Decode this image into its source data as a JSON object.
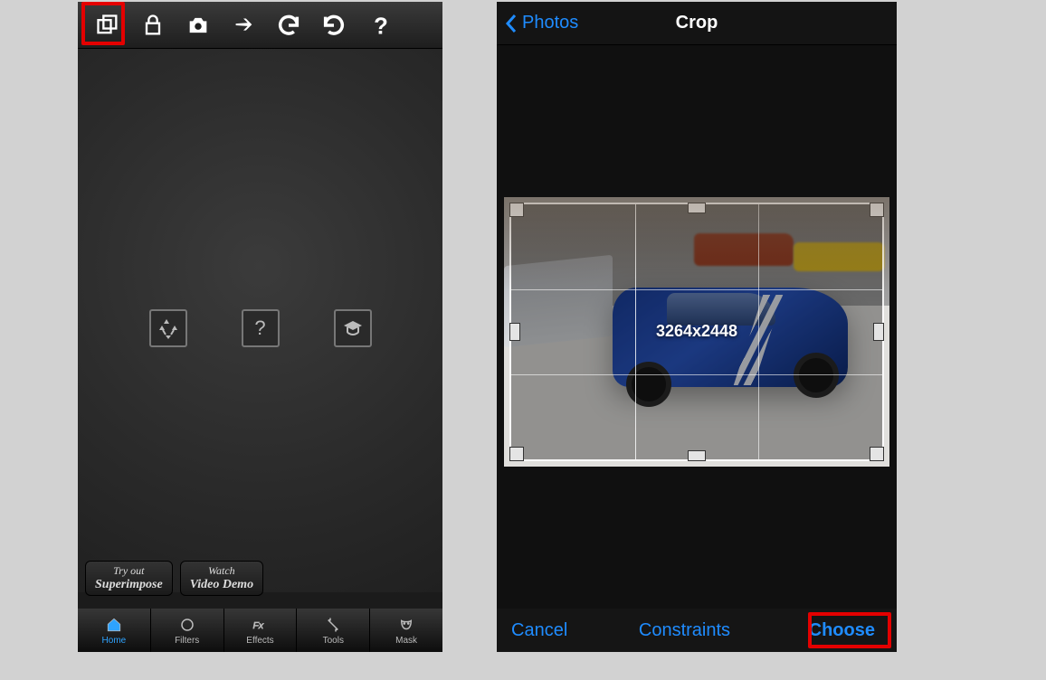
{
  "left": {
    "toolbar_icons": [
      "layers-icon",
      "lock-icon",
      "camera-icon",
      "share-icon",
      "undo-icon",
      "redo-icon",
      "help-icon"
    ],
    "center_icons": [
      "recycle-icon",
      "question-icon",
      "graduation-icon"
    ],
    "promo": {
      "tryout_line1": "Try out",
      "tryout_line2": "Superimpose",
      "watch_line1": "Watch",
      "watch_line2": "Video Demo"
    },
    "tabs": [
      {
        "id": "home",
        "label": "Home",
        "active": true
      },
      {
        "id": "filters",
        "label": "Filters",
        "active": false
      },
      {
        "id": "effects",
        "label": "Effects",
        "active": false
      },
      {
        "id": "tools",
        "label": "Tools",
        "active": false
      },
      {
        "id": "mask",
        "label": "Mask",
        "active": false
      }
    ],
    "highlighted_top_icon_index": 0
  },
  "right": {
    "back_label": "Photos",
    "title": "Crop",
    "crop_dimensions": "3264x2448",
    "bottom": {
      "cancel": "Cancel",
      "constraints": "Constraints",
      "choose": "Choose"
    },
    "highlighted_button": "choose"
  }
}
